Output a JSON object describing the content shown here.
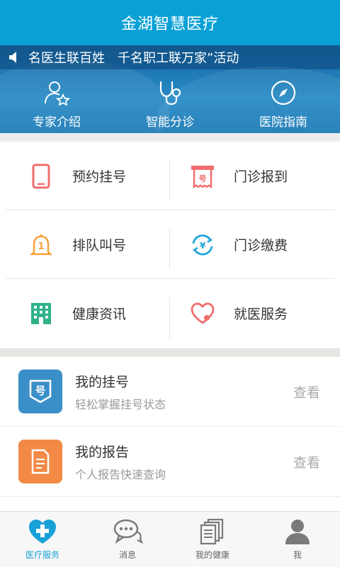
{
  "header": {
    "title": "金湖智慧医疗"
  },
  "notice": {
    "text": "名医生联百姓　千名职工联万家”活动"
  },
  "quick": [
    {
      "label": "专家介绍",
      "icon": "expert-star-icon"
    },
    {
      "label": "智能分诊",
      "icon": "stethoscope-icon"
    },
    {
      "label": "医院指南",
      "icon": "compass-icon"
    }
  ],
  "grid": [
    {
      "label": "预约挂号",
      "icon": "phone-booking-icon",
      "color": "#f26d6d"
    },
    {
      "label": "门诊报到",
      "icon": "ticket-icon",
      "color": "#f26d6d"
    },
    {
      "label": "排队叫号",
      "icon": "bell-icon",
      "color": "#f4a23c"
    },
    {
      "label": "门诊缴费",
      "icon": "yuan-refresh-icon",
      "color": "#23a6dc"
    },
    {
      "label": "健康资讯",
      "icon": "building-icon",
      "color": "#2fb28a"
    },
    {
      "label": "就医服务",
      "icon": "heart-icon",
      "color": "#f26d6d"
    }
  ],
  "cards": [
    {
      "title": "我的挂号",
      "subtitle": "轻松掌握挂号状态",
      "action": "查看",
      "icon": "registration-badge-icon",
      "color": "#3a8fc8",
      "glyph": "号"
    },
    {
      "title": "我的报告",
      "subtitle": "个人报告快速查询",
      "action": "查看",
      "icon": "report-document-icon",
      "color": "#f28a45"
    }
  ],
  "tabs": [
    {
      "label": "医疗服务",
      "icon": "medical-cross-heart-icon",
      "active": true
    },
    {
      "label": "消息",
      "icon": "chat-bubble-icon",
      "active": false
    },
    {
      "label": "我的健康",
      "icon": "documents-icon",
      "active": false
    },
    {
      "label": "我",
      "icon": "user-icon",
      "active": false
    }
  ],
  "colors": {
    "header": "#0aa0d6",
    "accent": "#1aa0d8",
    "divider": "#e6e6e6"
  }
}
